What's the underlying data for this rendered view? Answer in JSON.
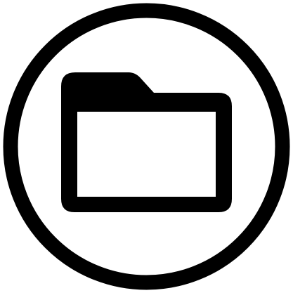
{
  "icon": {
    "name": "folder-in-circle-icon",
    "parts": [
      "outer-ring",
      "folder-icon"
    ]
  },
  "colors": {
    "foreground": "#000000",
    "background": "#ffffff"
  }
}
